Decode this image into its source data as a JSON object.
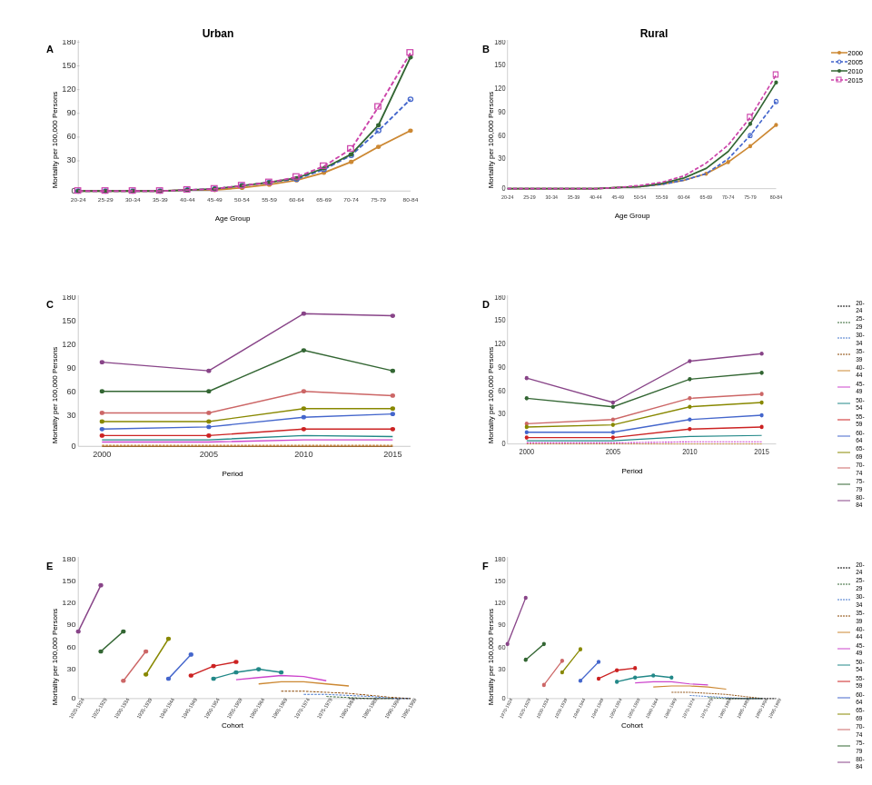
{
  "panels": {
    "A": {
      "title": "Urban",
      "xLabel": "Age Group",
      "label": "A"
    },
    "B": {
      "title": "Rural",
      "xLabel": "Age Group",
      "label": "B"
    },
    "C": {
      "title": "",
      "xLabel": "Period",
      "label": "C"
    },
    "D": {
      "title": "",
      "xLabel": "Period",
      "label": "D"
    },
    "E": {
      "title": "",
      "xLabel": "Cohort",
      "label": "E"
    },
    "F": {
      "title": "",
      "xLabel": "Cohort",
      "label": "F"
    }
  },
  "yLabel": "Mortality per 100,000 Persons",
  "legend_period_cohort": [
    "20-24",
    "25-29",
    "30-34",
    "35-39",
    "40-44",
    "45-49",
    "50-54",
    "55-59",
    "60-64",
    "65-69",
    "70-74",
    "75-79",
    "80-84"
  ],
  "legend_age": [
    "2000",
    "2005",
    "2010",
    "2015"
  ],
  "colors": {
    "2000": "#cc8833",
    "2005": "#4466cc",
    "2010": "#336633",
    "2015": "#cc44aa",
    "20-24": "#000000",
    "25-29": "#336633",
    "30-34": "#4477cc",
    "35-39": "#884400",
    "40-44": "#cc8833",
    "45-49": "#cc44cc",
    "50-54": "#228888",
    "55-59": "#cc2222",
    "60-64": "#4466cc",
    "65-69": "#888800",
    "70-74": "#cc6666",
    "75-79": "#336633",
    "80-84": "#884488"
  }
}
